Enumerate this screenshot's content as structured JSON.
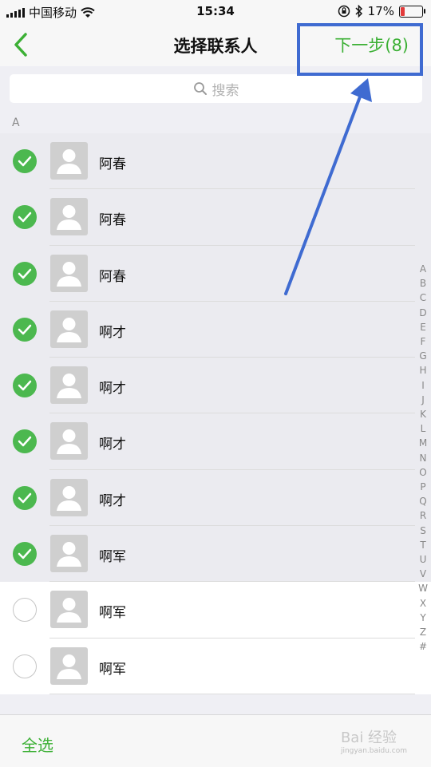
{
  "status": {
    "carrier": "中国移动",
    "time": "15:34",
    "battery": "17%",
    "battery_level": 0.17
  },
  "nav": {
    "title": "选择联系人",
    "next_label": "下一步(8)"
  },
  "search": {
    "placeholder": "搜索"
  },
  "section": {
    "letter": "A"
  },
  "contacts": [
    {
      "name": "阿春",
      "selected": true
    },
    {
      "name": "阿春",
      "selected": true
    },
    {
      "name": "阿春",
      "selected": true
    },
    {
      "name": "啊才",
      "selected": true
    },
    {
      "name": "啊才",
      "selected": true
    },
    {
      "name": "啊才",
      "selected": true
    },
    {
      "name": "啊才",
      "selected": true
    },
    {
      "name": "啊军",
      "selected": true
    },
    {
      "name": "啊军",
      "selected": false
    },
    {
      "name": "啊军",
      "selected": false
    }
  ],
  "index_letters": [
    "A",
    "B",
    "C",
    "D",
    "E",
    "F",
    "G",
    "H",
    "I",
    "J",
    "K",
    "L",
    "M",
    "N",
    "O",
    "P",
    "Q",
    "R",
    "S",
    "T",
    "U",
    "V",
    "W",
    "X",
    "Y",
    "Z",
    "#"
  ],
  "bottom": {
    "select_all": "全选"
  },
  "watermark": {
    "brand": "Bai 经验",
    "url": "jingyan.baidu.com"
  },
  "colors": {
    "accent": "#3cb035",
    "check": "#4cb84f",
    "annotation": "#3f6bd1",
    "battery_low": "#e23a3a"
  }
}
